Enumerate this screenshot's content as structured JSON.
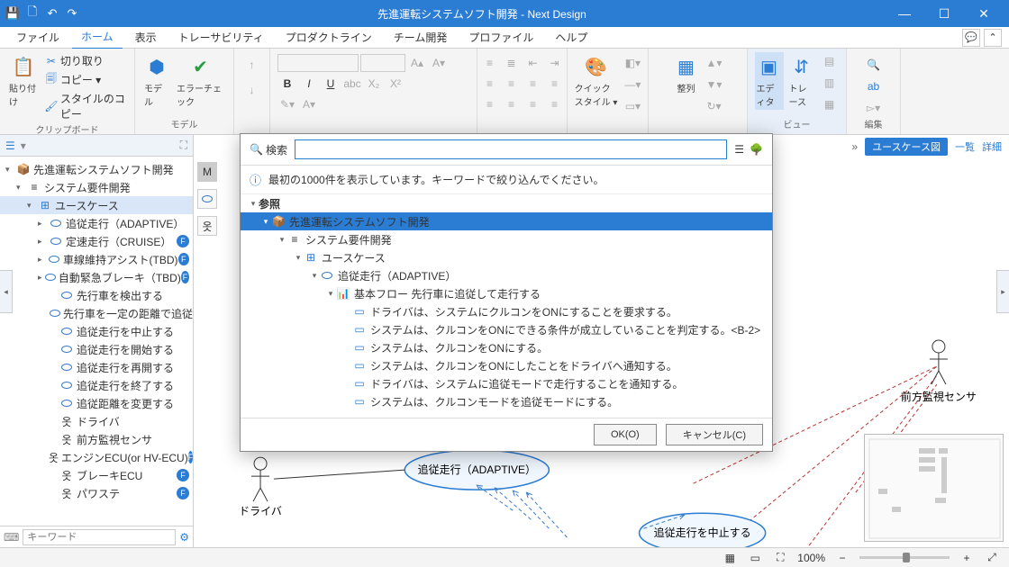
{
  "titlebar": {
    "title": "先進運転システムソフト開発 - Next Design"
  },
  "menu": {
    "tabs": [
      "ファイル",
      "ホーム",
      "表示",
      "トレーサビリティ",
      "プロダクトライン",
      "チーム開発",
      "プロファイル",
      "ヘルプ"
    ],
    "active": 1
  },
  "ribbon": {
    "g0": {
      "paste": "貼り付け",
      "cut": "切り取り",
      "copy": "コピー ▾",
      "style": "スタイルのコピー",
      "label": "クリップボード"
    },
    "g1": {
      "model": "モデル",
      "check": "エラーチェック",
      "label": "モデル"
    },
    "g2": {
      "quick": "クイック\nスタイル ▾"
    },
    "g3": {
      "seiretsu": "整列"
    },
    "g4": {
      "editor": "エディタ",
      "trace": "トレース",
      "label": "ビュー"
    },
    "g5": {
      "label": "編集"
    }
  },
  "sidebar": {
    "root": "先進運転システムソフト開発",
    "n1": "システム要件開発",
    "n2": "ユースケース",
    "uc": [
      "追従走行（ADAPTIVE）",
      "定速走行（CRUISE）",
      "車線維持アシスト(TBD)",
      "自動緊急ブレーキ（TBD)",
      "先行車を検出する",
      "先行車を一定の距離で追従",
      "追従走行を中止する",
      "追従走行を開始する",
      "追従走行を再開する",
      "追従走行を終了する",
      "追従距離を変更する"
    ],
    "actors": [
      "ドライバ",
      "前方監視センサ",
      "エンジンECU(or HV-ECU)",
      "ブレーキECU",
      "パワステ"
    ],
    "kw_placeholder": "キーワード"
  },
  "canvas": {
    "chip": "ユースケース図",
    "list": "一覧",
    "detail": "詳細",
    "driver": "ドライバ",
    "sensor": "前方監視センサ",
    "uc1": "追従走行（ADAPTIVE）",
    "uc2": "追従走行を中止する"
  },
  "dialog": {
    "search_label": "検索",
    "info": "最初の1000件を表示しています。キーワードで絞り込んでください。",
    "sec": "参照",
    "n0": "先進運転システムソフト開発",
    "n1": "システム要件開発",
    "n2": "ユースケース",
    "n3": "追従走行（ADAPTIVE）",
    "n4": "基本フロー 先行車に追従して走行する",
    "steps": [
      "ドライバは、システムにクルコンをONにすることを要求する。",
      "システムは、クルコンをONにできる条件が成立していることを判定する。<B-2>",
      "システムは、クルコンをONにする。",
      "システムは、クルコンをONにしたことをドライバへ通知する。",
      "ドライバは、システムに追従モードで走行することを通知する。",
      "システムは、クルコンモードを追従モードにする。"
    ],
    "ok": "OK(O)",
    "cancel": "キャンセル(C)"
  },
  "status": {
    "zoom": "100%"
  }
}
